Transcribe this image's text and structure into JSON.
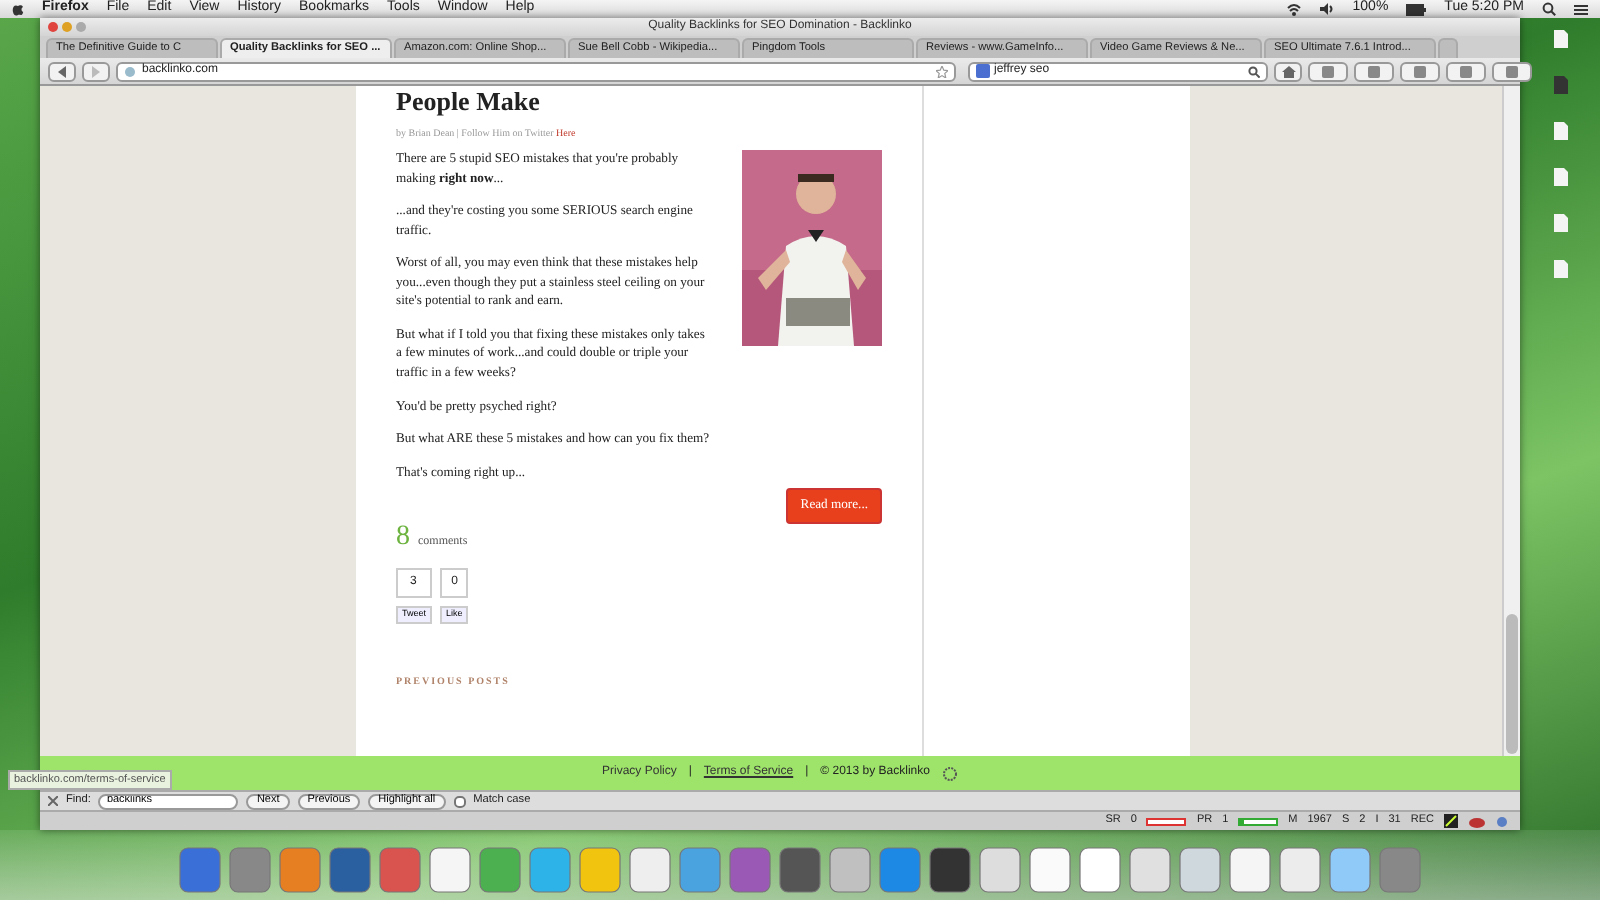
{
  "menu_bar": {
    "app": "Firefox",
    "items": [
      "File",
      "Edit",
      "View",
      "History",
      "Bookmarks",
      "Tools",
      "Window",
      "Help"
    ],
    "battery": "100%",
    "clock": "Tue 5:20 PM"
  },
  "window": {
    "title": "Quality Backlinks for SEO Domination - Backlinko"
  },
  "tabs": [
    {
      "label": "The Definitive Guide to C",
      "selected": false
    },
    {
      "label": "Quality Backlinks for SEO ...",
      "selected": true
    },
    {
      "label": "Amazon.com: Online Shop...",
      "selected": false
    },
    {
      "label": "Sue Bell Cobb - Wikipedia...",
      "selected": false
    },
    {
      "label": "Pingdom Tools",
      "selected": false
    },
    {
      "label": "Reviews - www.GameInfo...",
      "selected": false
    },
    {
      "label": "Video Game Reviews & Ne...",
      "selected": false
    },
    {
      "label": "SEO Ultimate 7.6.1 Introd...",
      "selected": false
    }
  ],
  "address": {
    "url": "backlinko.com"
  },
  "search": {
    "value": "jeffrey seo"
  },
  "article": {
    "title": "People Make",
    "byline": "by Brian Dean",
    "follow": "| Follow Him on Twitter",
    "follow_link": "Here",
    "paragraphs": [
      "There are 5 stupid SEO mistakes that you're probably making **right now**...",
      "...and they're costing you some SERIOUS search engine traffic.",
      "Worst of all, you may even think that these mistakes help you...even though they put a stainless steel ceiling on your site's potential to rank and earn.",
      "But what if I told you that fixing these mistakes only takes a few minutes of work...and could double or triple your traffic in a few weeks?",
      "You'd be pretty psyched right?",
      "But what ARE these 5 mistakes and how can you fix them?",
      "That's coming right up..."
    ],
    "read_more": "Read more...",
    "comment_count": "8",
    "comments_label": "comments",
    "tweet_count": "3",
    "like_count": "0",
    "tweet": "Tweet",
    "like": "Like"
  },
  "previous_posts": "PREVIOUS POSTS",
  "footer": {
    "links": [
      "Privacy Policy",
      "Terms of Service"
    ],
    "separators": [
      "|",
      "|"
    ],
    "copyright": "© 2013 by Backlinko"
  },
  "status_link": "backlinko.com/terms-of-service",
  "find_bar": {
    "label": "Find:",
    "value": "backlinks",
    "buttons": [
      "Next",
      "Previous"
    ],
    "highlight_all": "Highlight all",
    "match_case": {
      "label": "Match case",
      "checked": false
    }
  },
  "addon_bar": [
    {
      "kind": "meter",
      "label": "SR",
      "value": "0",
      "level": 0
    },
    {
      "kind": "meter",
      "label": "PR",
      "value": "1",
      "level": 0.1
    },
    {
      "kind": "text",
      "label": "M",
      "value": "1967"
    },
    {
      "kind": "text",
      "label": "S",
      "value": "2"
    },
    {
      "kind": "text",
      "label": "I",
      "value": "31"
    },
    {
      "kind": "text",
      "label": "REC"
    }
  ]
}
